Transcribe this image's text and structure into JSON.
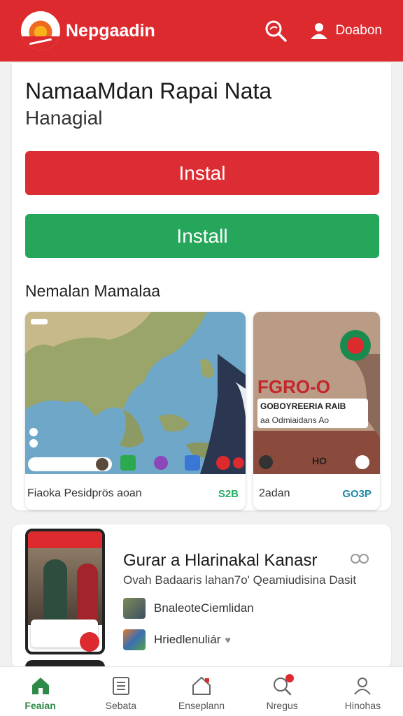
{
  "header": {
    "brand": "Nepgaadin",
    "user_label": "Doabon",
    "icons": [
      "sun-logo-icon",
      "search-icon",
      "user-icon"
    ]
  },
  "app": {
    "title": "NamaaMdan Rapai Nata",
    "subtitle": "Hanagial",
    "install_red_label": "Instal",
    "install_green_label": "Install",
    "screenshots_heading": "Nemalan Mamalaa",
    "screenshots": [
      {
        "caption": "Fiaoka Pesidprös aoan",
        "meta": "S2B"
      },
      {
        "caption": "2adan",
        "meta": "GO3P",
        "promo_big": "FGRO-O",
        "promo_line1": "GOBOYREERIA RAIB",
        "promo_line2": "aa Odmiaidans Ao",
        "promo_badge": "HO"
      }
    ]
  },
  "related": {
    "title": "Gurar a Hlarinakal Kanasr",
    "description": "Ovah Badaaris lahan7o' Qeamiudisina Dasit",
    "rows": [
      {
        "label": "BnaleoteCiemlidan"
      },
      {
        "label": "Hriedlenuliár"
      }
    ]
  },
  "bottom_nav": [
    {
      "label": "Feaian",
      "icon": "home-icon",
      "active": true
    },
    {
      "label": "Sebata",
      "icon": "list-icon",
      "active": false
    },
    {
      "label": "Enseplann",
      "icon": "store-icon",
      "active": false
    },
    {
      "label": "Nregus",
      "icon": "search-notification-icon",
      "active": false
    },
    {
      "label": "Hinohas",
      "icon": "profile-icon",
      "active": false
    }
  ],
  "colors": {
    "header_red": "#dd2a2f",
    "install_red": "#dc2d34",
    "install_green": "#26a65b",
    "nav_active": "#2d8a48"
  }
}
